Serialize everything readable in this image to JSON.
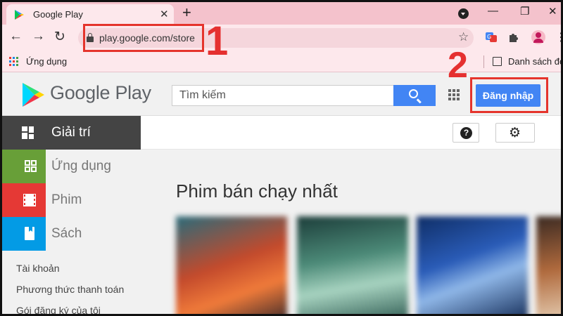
{
  "browser": {
    "tab_title": "Google Play",
    "new_tab": "+",
    "close_tab": "✕",
    "url": "play.google.com/store",
    "back": "←",
    "forward": "→",
    "reload": "↻",
    "star": "☆",
    "menu": "⋮",
    "window_controls": {
      "minimize": "—",
      "restore": "❐",
      "close": "✕"
    }
  },
  "bookmarks": {
    "apps_label": "Ứng dụng",
    "reading_list_label": "Danh sách đọ"
  },
  "annotations": {
    "step1": "1",
    "step2": "2",
    "highlight_color": "#e5342c"
  },
  "play": {
    "logo_text": "Google Play",
    "search_placeholder": "Tìm kiếm",
    "signin_label": "Đăng nhập"
  },
  "sidebar": {
    "categories": [
      {
        "label": "Giải trí",
        "color": "#444444",
        "icon": "entertainment-icon"
      },
      {
        "label": "Ứng dụng",
        "color": "#689f38",
        "icon": "apps-icon"
      },
      {
        "label": "Phim",
        "color": "#e53935",
        "icon": "movie-icon"
      },
      {
        "label": "Sách",
        "color": "#039be5",
        "icon": "book-icon"
      }
    ],
    "links": [
      "Tài khoản",
      "Phương thức thanh toán",
      "Gói đăng ký của tôi"
    ]
  },
  "main": {
    "section_title": "Phim bán chạy nhất",
    "help_icon_glyph": "?",
    "settings_icon_glyph": "⚙"
  },
  "colors": {
    "accent": "#4285f4",
    "tab_bg": "#f4c2cc",
    "toolbar_bg": "#fde8ec"
  }
}
